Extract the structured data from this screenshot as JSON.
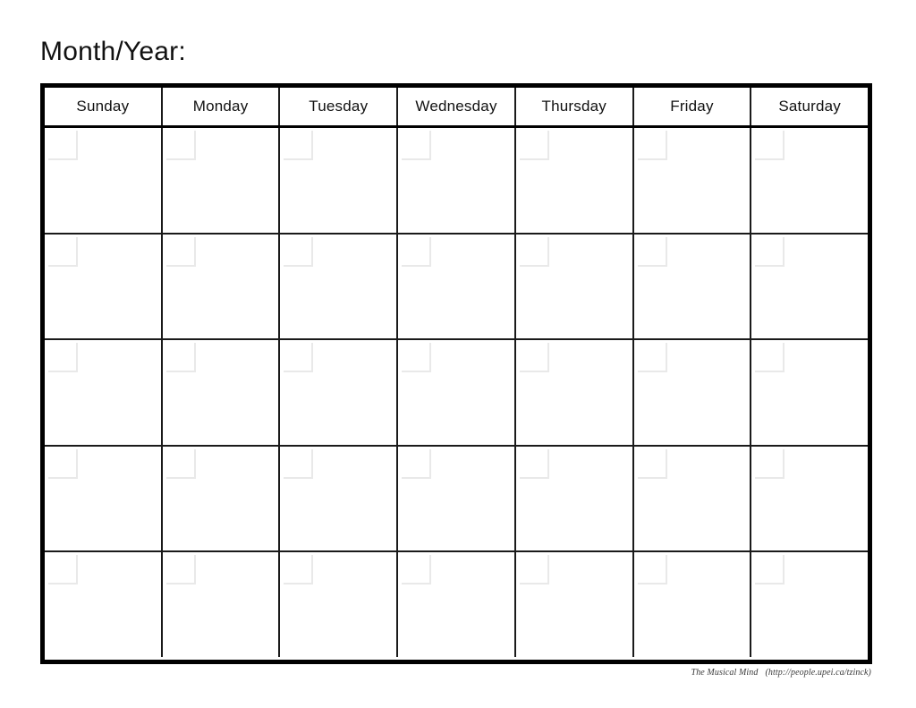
{
  "document": {
    "type": "blank-monthly-calendar-template",
    "title_label": "Month/Year:"
  },
  "calendar": {
    "day_headers": [
      "Sunday",
      "Monday",
      "Tuesday",
      "Wednesday",
      "Thursday",
      "Friday",
      "Saturday"
    ],
    "week_rows": 5,
    "columns": 7,
    "cells_are_blank": true,
    "date_box_present_in_each_cell": true
  },
  "footer": {
    "credit_name": "The Musical Mind",
    "credit_url": "(http://people.upei.ca/tzinck)"
  },
  "colors": {
    "page_background": "#ffffff",
    "outer_border": "#000000",
    "grid_line": "#1a1a1a",
    "date_box_line": "#e9e9e9",
    "text": "#111111",
    "footer_text": "#3a3a3a"
  }
}
